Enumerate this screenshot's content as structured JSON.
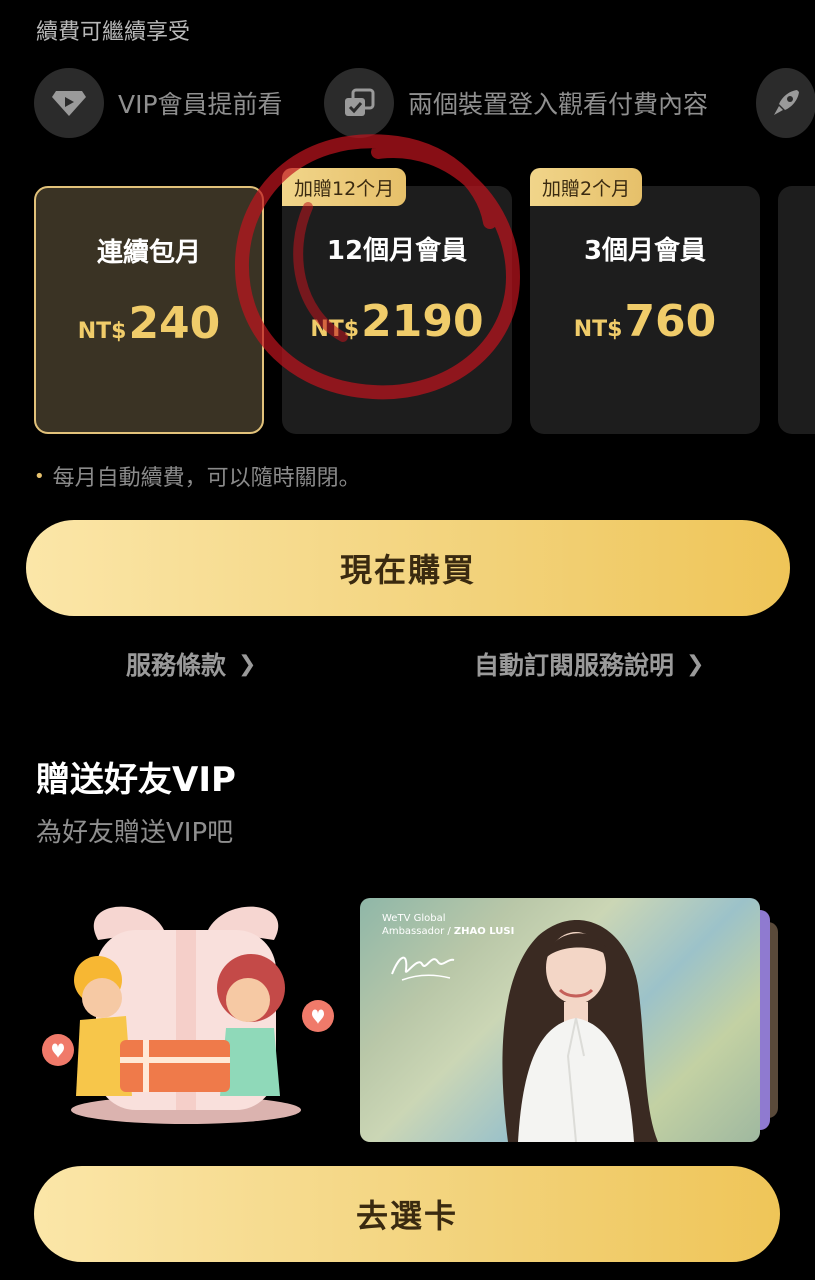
{
  "renew_caption": "續費可繼續享受",
  "benefits": [
    {
      "icon": "play-badge-icon",
      "label": "VIP會員提前看"
    },
    {
      "icon": "two-devices-icon",
      "label": "兩個裝置登入觀看付費內容"
    },
    {
      "icon": "rocket-icon",
      "label": ""
    }
  ],
  "plans": [
    {
      "name": "連續包月",
      "currency": "NT$",
      "amount": "240",
      "badge": "",
      "selected": true
    },
    {
      "name": "12個月會員",
      "currency": "NT$",
      "amount": "2190",
      "badge": "加贈12个月",
      "selected": false
    },
    {
      "name": "3個月會員",
      "currency": "NT$",
      "amount": "760",
      "badge": "加贈2个月",
      "selected": false
    }
  ],
  "auto_renew_note": "每月自動續費，可以隨時關閉。",
  "buy_button": "現在購買",
  "links": {
    "terms": "服務條款",
    "auto_subscription": "自動訂閱服務說明"
  },
  "gift": {
    "title": "贈送好友VIP",
    "subtitle": "為好友贈送VIP吧",
    "card_brand_line1": "WeTV Global",
    "card_brand_line2": "Ambassador / ",
    "card_brand_name": "ZHAO LUSI",
    "choose_button": "去選卡"
  },
  "colors": {
    "accent_gold": "#f0cc6a",
    "button_gold": "#f2d27a",
    "annotation_red": "#c0141e"
  }
}
